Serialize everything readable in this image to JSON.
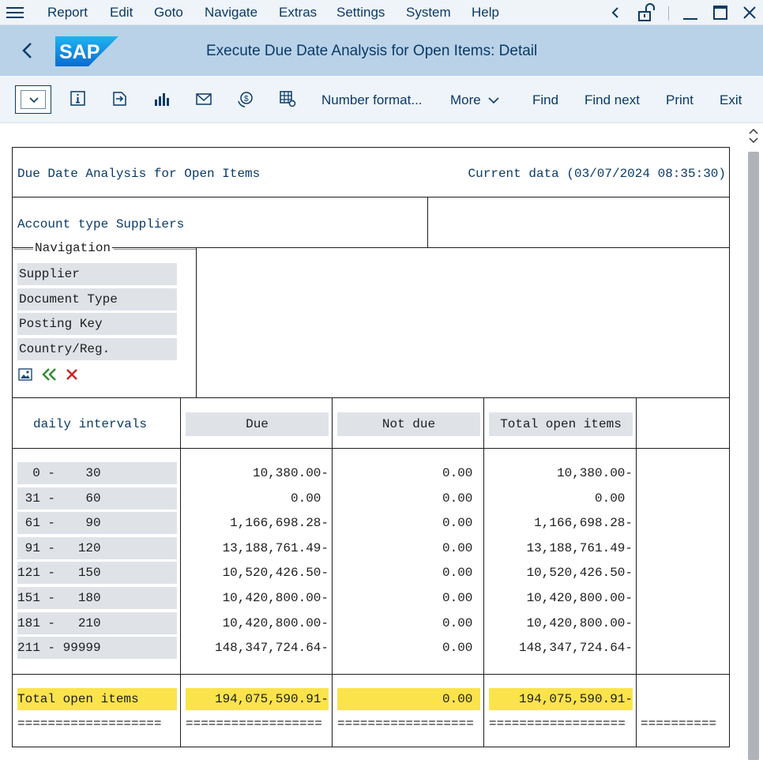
{
  "menu": {
    "items": [
      "Report",
      "Edit",
      "Goto",
      "Navigate",
      "Extras",
      "Settings",
      "System",
      "Help"
    ]
  },
  "titlebar": {
    "title": "Execute Due Date Analysis for Open Items: Detail",
    "logo_text": "SAP"
  },
  "toolbar": {
    "number_format": "Number format...",
    "more": "More",
    "find": "Find",
    "find_next": "Find next",
    "print": "Print",
    "exit": "Exit",
    "icons": [
      "info-icon",
      "export-icon",
      "chart-icon",
      "mail-icon",
      "currency-icon",
      "table-settings-icon"
    ]
  },
  "report": {
    "heading": "Due Date Analysis for Open Items",
    "current_data": "Current data (03/07/2024 08:35:30)",
    "account_type": "Account type Suppliers",
    "navigation": {
      "title": "Navigation",
      "items": [
        "Supplier",
        "Document Type",
        "Posting Key",
        "Country/Reg."
      ]
    },
    "columns": {
      "interval": "daily intervals",
      "due": "Due",
      "not_due": "Not due",
      "total": "Total open items"
    },
    "rows": [
      {
        "interval": "  0 -    30",
        "due": "10,380.00-",
        "not_due": "0.00 ",
        "total": "10,380.00-"
      },
      {
        "interval": " 31 -    60",
        "due": "0.00 ",
        "not_due": "0.00 ",
        "total": "0.00 "
      },
      {
        "interval": " 61 -    90",
        "due": "1,166,698.28-",
        "not_due": "0.00 ",
        "total": "1,166,698.28-"
      },
      {
        "interval": " 91 -   120",
        "due": "13,188,761.49-",
        "not_due": "0.00 ",
        "total": "13,188,761.49-"
      },
      {
        "interval": "121 -   150",
        "due": "10,520,426.50-",
        "not_due": "0.00 ",
        "total": "10,520,426.50-"
      },
      {
        "interval": "151 -   180",
        "due": "10,420,800.00-",
        "not_due": "0.00 ",
        "total": "10,420,800.00-"
      },
      {
        "interval": "181 -   210",
        "due": "10,420,800.00-",
        "not_due": "0.00 ",
        "total": "10,420,800.00-"
      },
      {
        "interval": "211 - 99999",
        "due": "148,347,724.64-",
        "not_due": "0.00 ",
        "total": "148,347,724.64-"
      }
    ],
    "total_row": {
      "label": "Total open items",
      "due": "194,075,590.91-",
      "not_due": "0.00 ",
      "total": "194,075,590.91-"
    },
    "underline_a": "===================",
    "underline_b": "==================",
    "underline_c": "=========="
  },
  "colors": {
    "brand_blue": "#0a3a68",
    "title_bar": "#b9d2e8",
    "highlight_yellow": "#fbe34c",
    "cell_gray": "#dfe3e8"
  }
}
